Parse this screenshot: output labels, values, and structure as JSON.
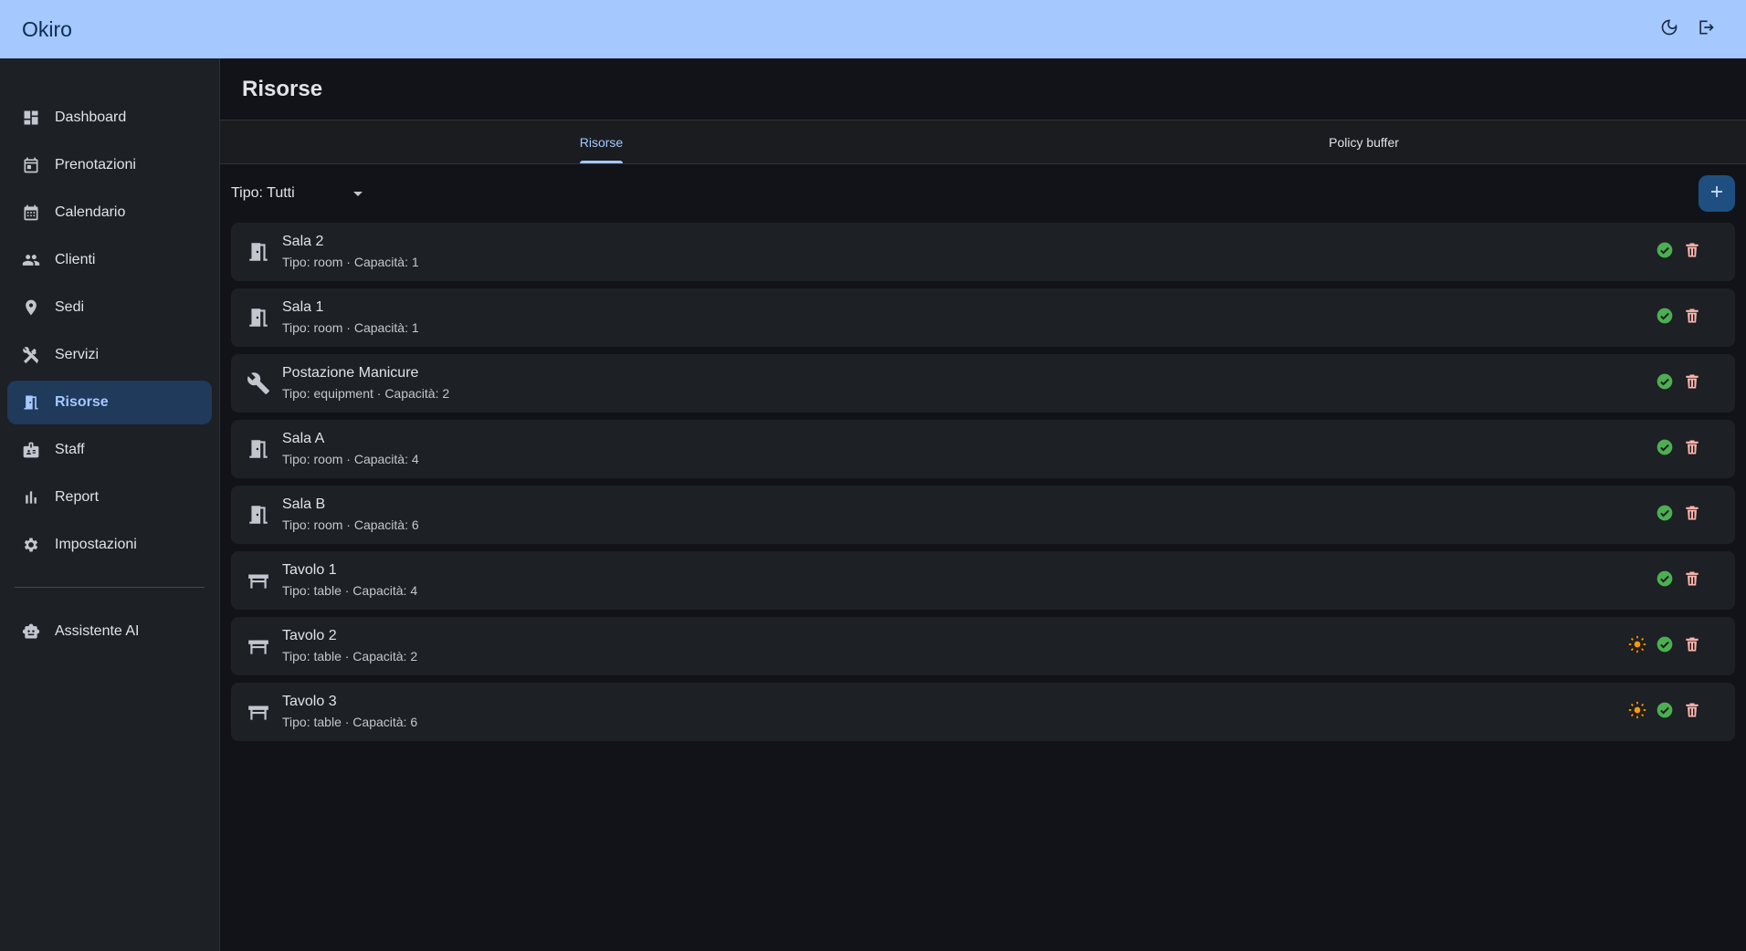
{
  "app": {
    "title": "Okiro"
  },
  "topbar": {
    "icons": [
      "moon-icon",
      "logout-icon"
    ]
  },
  "sidebar": {
    "items": [
      {
        "label": "Dashboard",
        "icon": "dashboard-icon"
      },
      {
        "label": "Prenotazioni",
        "icon": "calendar-event-icon"
      },
      {
        "label": "Calendario",
        "icon": "calendar-month-icon"
      },
      {
        "label": "Clienti",
        "icon": "people-icon"
      },
      {
        "label": "Sedi",
        "icon": "location-pin-icon"
      },
      {
        "label": "Servizi",
        "icon": "tools-icon"
      },
      {
        "label": "Risorse",
        "icon": "door-icon",
        "active": true
      },
      {
        "label": "Staff",
        "icon": "badge-icon"
      },
      {
        "label": "Report",
        "icon": "bar-chart-icon"
      },
      {
        "label": "Impostazioni",
        "icon": "gear-icon"
      }
    ],
    "assistant": {
      "label": "Assistente AI",
      "icon": "robot-icon"
    }
  },
  "page": {
    "title": "Risorse"
  },
  "tabs": [
    {
      "label": "Risorse",
      "active": true
    },
    {
      "label": "Policy buffer",
      "active": false
    }
  ],
  "toolbar": {
    "filter_label": "Tipo: Tutti",
    "add_icon": "plus-icon"
  },
  "resources": [
    {
      "name": "Sala 2",
      "subtitle": "Tipo: room · Capacità: 1",
      "icon": "door-icon",
      "outdoor": false
    },
    {
      "name": "Sala 1",
      "subtitle": "Tipo: room · Capacità: 1",
      "icon": "door-icon",
      "outdoor": false
    },
    {
      "name": "Postazione Manicure",
      "subtitle": "Tipo: equipment · Capacità: 2",
      "icon": "wrench-icon",
      "outdoor": false
    },
    {
      "name": "Sala A",
      "subtitle": "Tipo: room · Capacità: 4",
      "icon": "door-icon",
      "outdoor": false
    },
    {
      "name": "Sala B",
      "subtitle": "Tipo: room · Capacità: 6",
      "icon": "door-icon",
      "outdoor": false
    },
    {
      "name": "Tavolo 1",
      "subtitle": "Tipo: table · Capacità: 4",
      "icon": "table-icon",
      "outdoor": false
    },
    {
      "name": "Tavolo 2",
      "subtitle": "Tipo: table · Capacità: 2",
      "icon": "table-icon",
      "outdoor": true
    },
    {
      "name": "Tavolo 3",
      "subtitle": "Tipo: table · Capacità: 6",
      "icon": "table-icon",
      "outdoor": true
    }
  ],
  "colors": {
    "topbar": "#a5c8ff",
    "active_nav": "#1f3a5a",
    "accent": "#a5c8ff",
    "check": "#4caf50",
    "delete": "#ffb4ab",
    "sun": "#ff9800",
    "fab": "#1f4f80"
  }
}
